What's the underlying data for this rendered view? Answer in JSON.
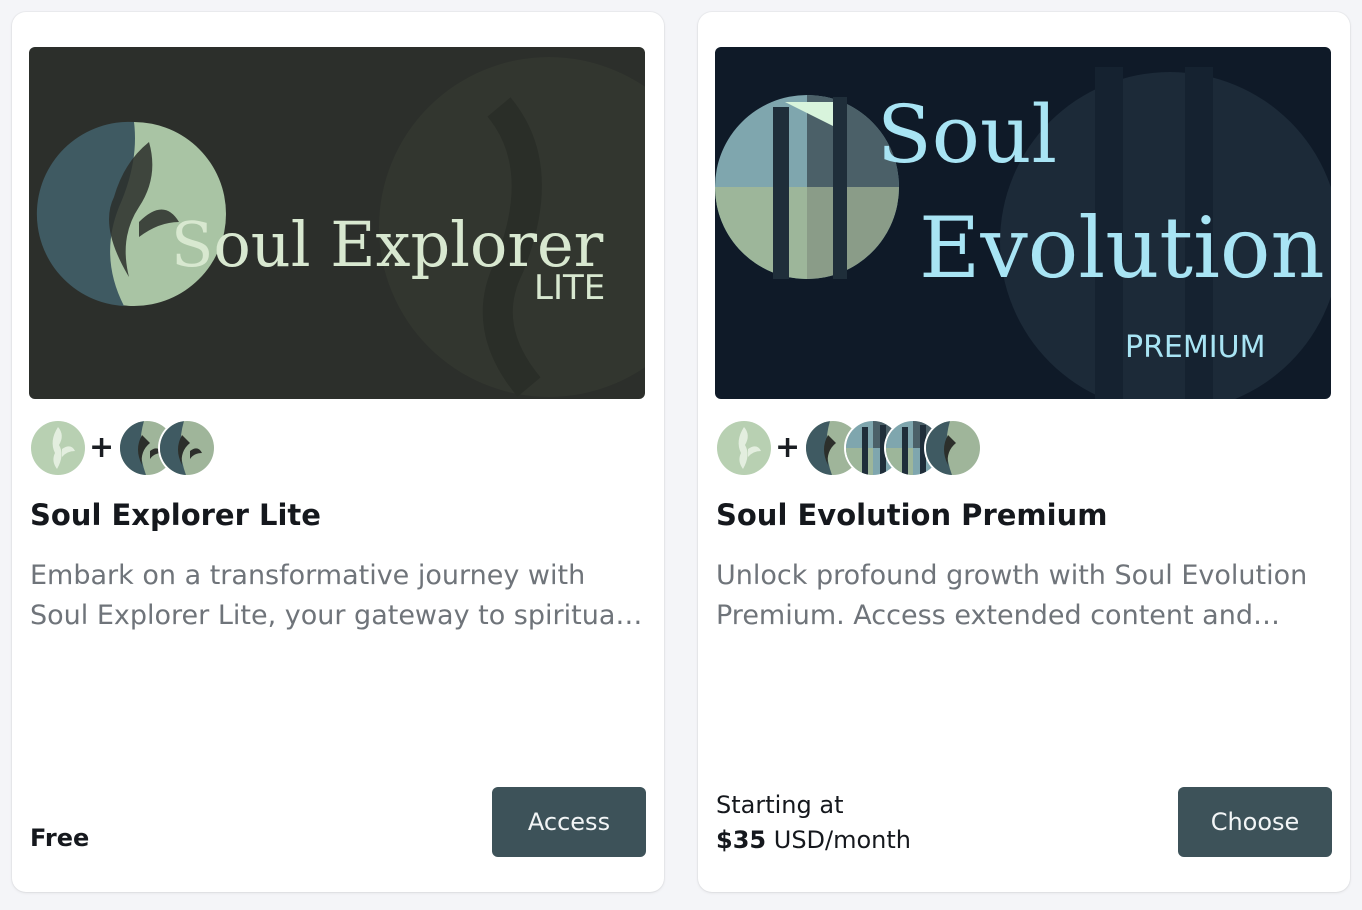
{
  "cards": [
    {
      "banner": {
        "logo_main": "Soul Explorer",
        "logo_sub": "LITE",
        "bg_color": "#2c2f2b",
        "text_color": "#d8e8d0"
      },
      "icon_names": [
        "explorer-lite-icon",
        "explorer-icon",
        "explorer-icon"
      ],
      "plus": "+",
      "title": "Soul Explorer Lite",
      "description": "Embark on a transformative journey with Soul Explorer Lite, your gateway to spiritual growth and self-discovery.",
      "price": "Free",
      "button_label": "Access"
    },
    {
      "banner": {
        "logo_line1": "Soul",
        "logo_line2": "Evolution",
        "logo_sub": "PREMIUM",
        "bg_color": "#0f1a28",
        "text_color": "#a8e4f4"
      },
      "icon_names": [
        "explorer-lite-icon",
        "explorer-icon",
        "evolution-icon",
        "evolution-icon",
        "explorer-icon"
      ],
      "plus": "+",
      "title": "Soul Evolution Premium",
      "description": "Unlock profound growth with Soul Evolution Premium. Access extended content and deeper practices.",
      "price_prefix": "Starting at",
      "price_amount": "$35",
      "price_unit": "USD/month",
      "button_label": "Choose"
    }
  ],
  "colors": {
    "page_bg": "#f4f5f8",
    "button_bg": "#3d5259",
    "muted_text": "#6f747a"
  }
}
